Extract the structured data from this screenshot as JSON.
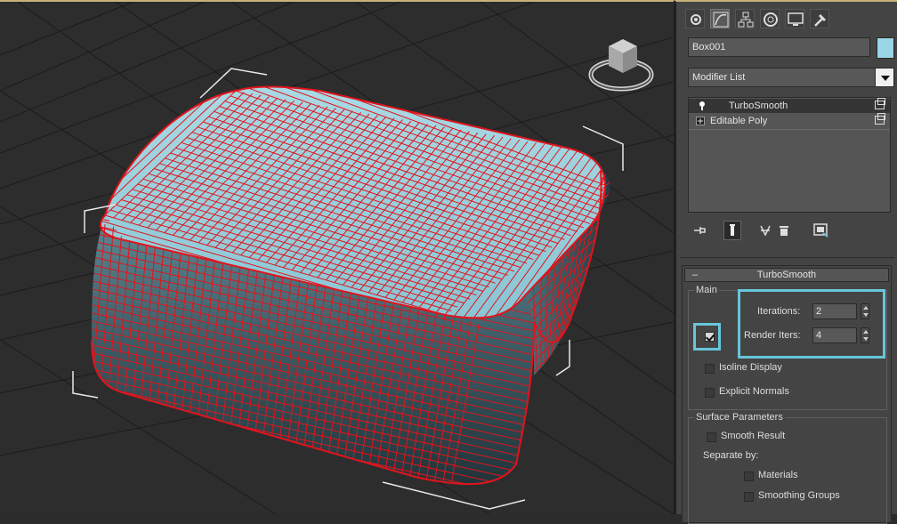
{
  "command_panel": {
    "tabs": [
      {
        "name": "create-tab",
        "icon": "gear-star-icon"
      },
      {
        "name": "modify-tab",
        "icon": "curve-icon"
      },
      {
        "name": "hierarchy-tab",
        "icon": "hierarchy-icon"
      },
      {
        "name": "motion-tab",
        "icon": "motion-icon"
      },
      {
        "name": "display-tab",
        "icon": "monitor-icon"
      },
      {
        "name": "utilities-tab",
        "icon": "hammer-icon"
      }
    ],
    "object_name": "Box001",
    "object_color": "#9ad6e6",
    "modifier_list_label": "Modifier List",
    "stack": [
      {
        "label": "TurboSmooth",
        "selected": true,
        "icon": "lightbulb-icon"
      },
      {
        "label": "Editable Poly",
        "selected": false,
        "icon": "plus-icon"
      }
    ]
  },
  "turbosmooth": {
    "rollout_title": "TurboSmooth",
    "collapse_symbol": "–",
    "main_group": "Main",
    "iterations_label": "Iterations:",
    "iterations_value": "2",
    "render_iters_label": "Render Iters:",
    "render_iters_value": "4",
    "render_iters_checked": true,
    "isoline_label": "Isoline Display",
    "isoline_checked": false,
    "explicit_normals_label": "Explicit Normals",
    "explicit_normals_checked": false,
    "surface_group": "Surface Parameters",
    "smooth_result_label": "Smooth Result",
    "smooth_result_checked": false,
    "separate_by_label": "Separate by:",
    "materials_label": "Materials",
    "materials_checked": false,
    "smoothing_groups_label": "Smoothing Groups",
    "smoothing_groups_checked": false
  },
  "colors": {
    "highlight": "#68c6d9",
    "wire": "#e0141c",
    "mesh_surface": "#8fc9d8"
  }
}
